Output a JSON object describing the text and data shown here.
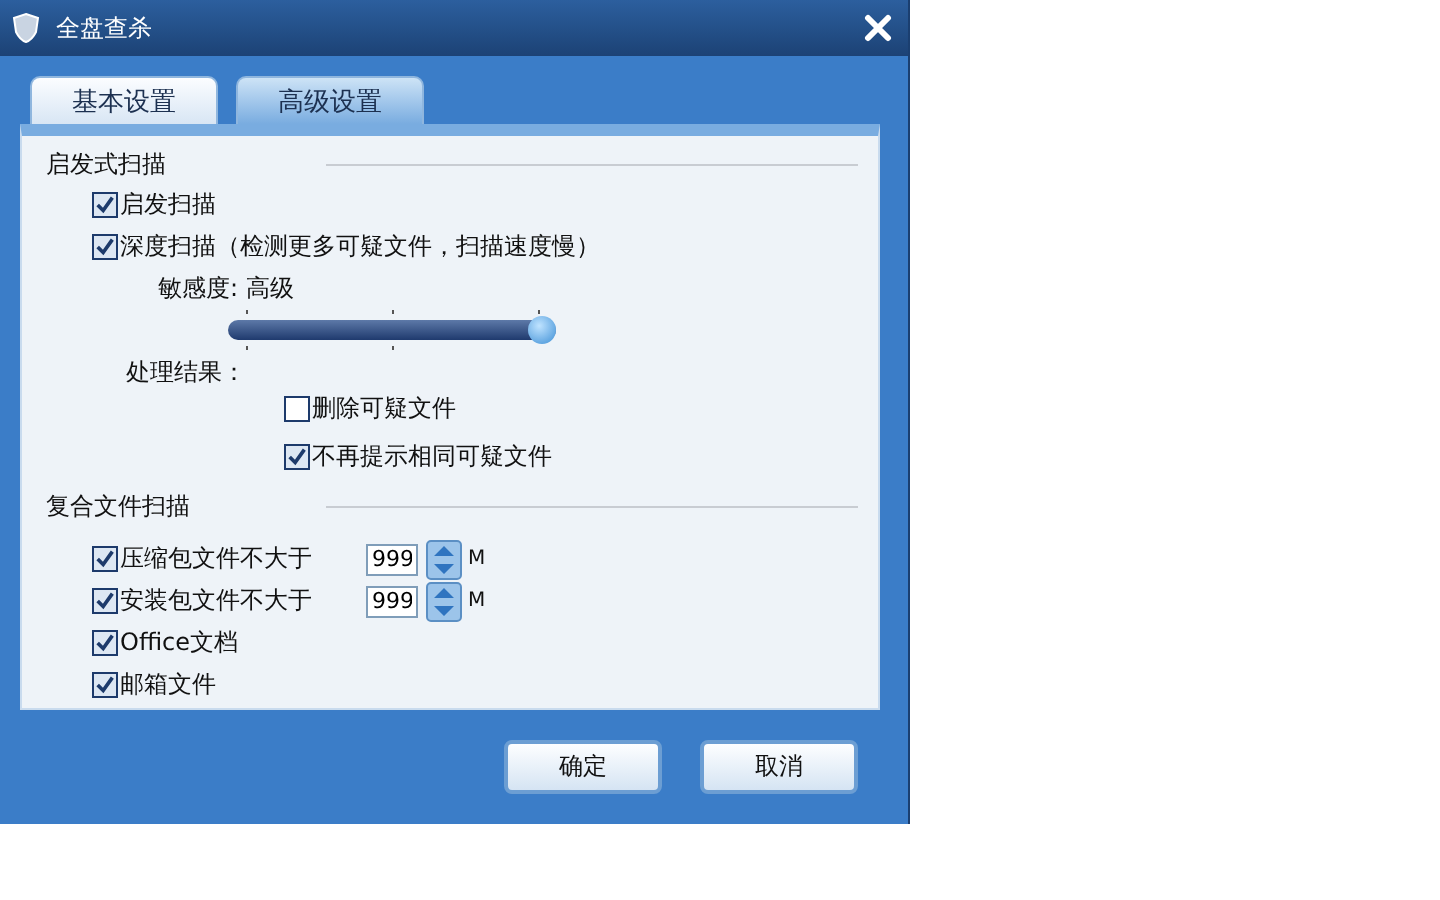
{
  "window": {
    "title": "全盘查杀"
  },
  "tabs": [
    {
      "label": "基本设置",
      "selected": false
    },
    {
      "label": "高级设置",
      "selected": true
    }
  ],
  "heuristic": {
    "heading": "启发式扫描",
    "options": [
      {
        "label": "启发扫描",
        "checked": true
      },
      {
        "label": "深度扫描（检测更多可疑文件，扫描速度慢）",
        "checked": true
      }
    ],
    "sensitivity": {
      "label": "敏感度:",
      "value": "高级",
      "level": 1
    },
    "result_label": "处理结果：",
    "result_options": [
      {
        "label": "删除可疑文件",
        "checked": false
      },
      {
        "label": "不再提示相同可疑文件",
        "checked": true
      }
    ]
  },
  "compound": {
    "heading": "复合文件扫描",
    "options": [
      {
        "kind": "size",
        "label": "压缩包文件不大于",
        "checked": true,
        "value": "999",
        "unit": "M"
      },
      {
        "kind": "size",
        "label": "安装包文件不大于",
        "checked": true,
        "value": "999",
        "unit": "M"
      },
      {
        "kind": "plain",
        "label": "Office文档",
        "checked": true
      },
      {
        "kind": "plain",
        "label": "邮箱文件",
        "checked": true
      }
    ]
  },
  "buttons": [
    "确定",
    "取消"
  ]
}
